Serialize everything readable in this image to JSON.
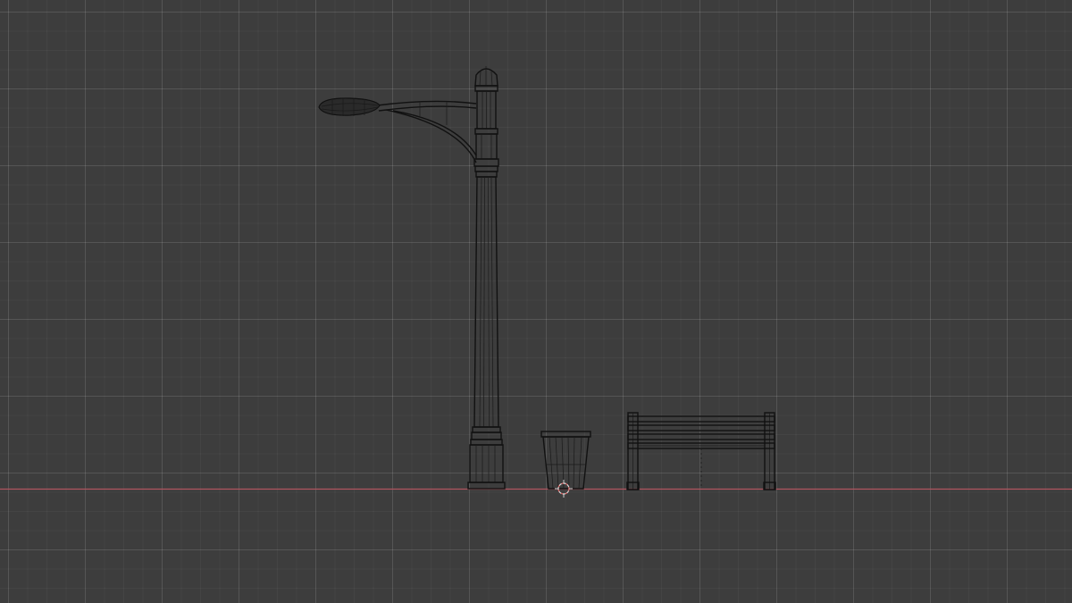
{
  "viewport": {
    "mode": "wireframe",
    "background_color": "#3d3d3d",
    "grid": true,
    "axis_x_color": "#b0555f",
    "cursor_color": "#d0d0d0"
  },
  "objects": [
    {
      "name": "street-lamp",
      "shading": "wireframe"
    },
    {
      "name": "trash-bin",
      "shading": "wireframe"
    },
    {
      "name": "park-bench",
      "shading": "wireframe"
    }
  ]
}
